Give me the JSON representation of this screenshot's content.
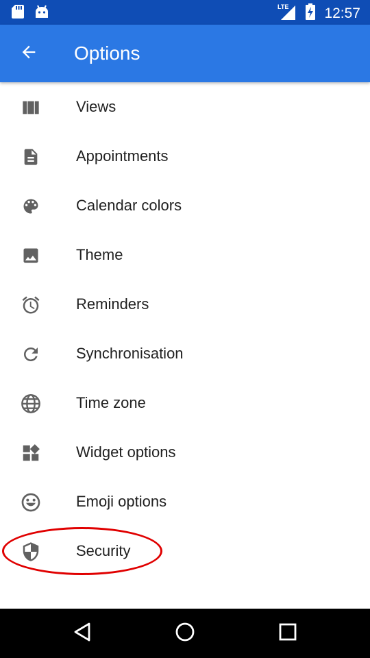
{
  "status_bar": {
    "time": "12:57",
    "network": "LTE",
    "icons": [
      "sd-card-icon",
      "android-icon",
      "lte-signal-icon",
      "battery-charging-icon"
    ]
  },
  "app_bar": {
    "title": "Options",
    "back_icon": "arrow-back-icon"
  },
  "options": [
    {
      "label": "Views",
      "icon": "views-icon"
    },
    {
      "label": "Appointments",
      "icon": "document-icon"
    },
    {
      "label": "Calendar colors",
      "icon": "palette-icon"
    },
    {
      "label": "Theme",
      "icon": "image-icon"
    },
    {
      "label": "Reminders",
      "icon": "alarm-icon"
    },
    {
      "label": "Synchronisation",
      "icon": "refresh-icon"
    },
    {
      "label": "Time zone",
      "icon": "globe-icon"
    },
    {
      "label": "Widget options",
      "icon": "widgets-icon"
    },
    {
      "label": "Emoji options",
      "icon": "emoji-icon"
    },
    {
      "label": "Security",
      "icon": "shield-icon"
    }
  ],
  "annotation": {
    "color": "#E00000",
    "target": "Security"
  },
  "colors": {
    "status_bar": "#0F4DB5",
    "app_bar": "#2B78E4",
    "icon": "#616161",
    "text": "#212121",
    "nav_bar": "#000000"
  },
  "nav_bar": {
    "buttons": [
      "back-triangle-icon",
      "home-circle-icon",
      "recents-square-icon"
    ]
  }
}
